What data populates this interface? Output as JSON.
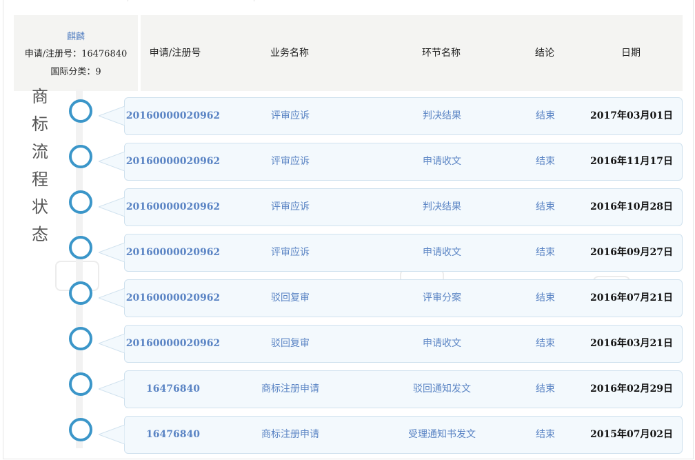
{
  "trademark": {
    "name": "麒麟",
    "reg_line": "申请/注册号：16476840",
    "class_line": "国际分类：9"
  },
  "side_title": [
    "商",
    "标",
    "流",
    "程",
    "状",
    "态"
  ],
  "header": {
    "col_number": "申请/注册号",
    "col_business": "业务名称",
    "col_step": "环节名称",
    "col_result": "结论",
    "col_date": "日期"
  },
  "rows": [
    {
      "number": "20160000020962",
      "business": "评审应诉",
      "step": "判决结果",
      "result": "结束",
      "date": "2017年03月01日"
    },
    {
      "number": "20160000020962",
      "business": "评审应诉",
      "step": "申请收文",
      "result": "结束",
      "date": "2016年11月17日"
    },
    {
      "number": "20160000020962",
      "business": "评审应诉",
      "step": "判决结果",
      "result": "结束",
      "date": "2016年10月28日"
    },
    {
      "number": "20160000020962",
      "business": "评审应诉",
      "step": "申请收文",
      "result": "结束",
      "date": "2016年09月27日"
    },
    {
      "number": "20160000020962",
      "business": "驳回复审",
      "step": "评审分案",
      "result": "结束",
      "date": "2016年07月21日"
    },
    {
      "number": "20160000020962",
      "business": "驳回复审",
      "step": "申请收文",
      "result": "结束",
      "date": "2016年03月21日"
    },
    {
      "number": "16476840",
      "business": "商标注册申请",
      "step": "驳回通知发文",
      "result": "结束",
      "date": "2016年02月29日"
    },
    {
      "number": "16476840",
      "business": "商标注册申请",
      "step": "受理通知书发文",
      "result": "结束",
      "date": "2015年07月02日"
    }
  ],
  "colors": {
    "accent_blue": "#5a84c4",
    "timeline_circle": "#3b96c9",
    "row_bg": "#f3f9fd",
    "row_border": "#cfe1ee",
    "header_bg": "#f4f4f2"
  }
}
